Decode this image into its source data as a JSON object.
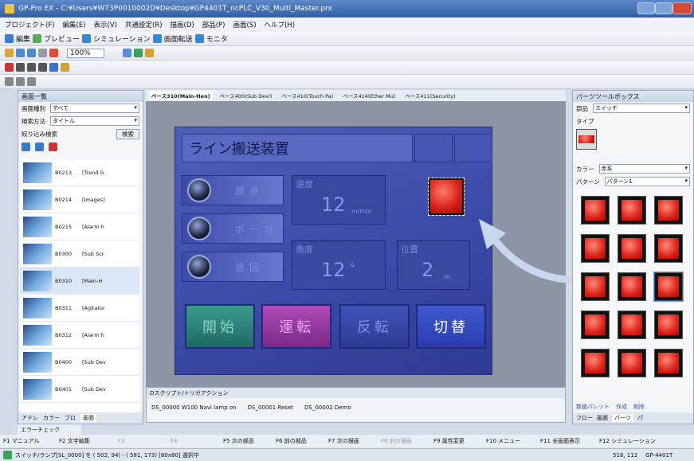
{
  "window": {
    "title": "GP-Pro EX - C:¥Users¥W73P0010002D¥Desktop¥GP4401T_ncPLC_V30_Multi_Master.prx"
  },
  "menu": [
    "プロジェクト(F)",
    "編集(E)",
    "表示(V)",
    "共通設定(R)",
    "描画(D)",
    "部品(P)",
    "画面(S)",
    "ヘルプ(H)"
  ],
  "toolbar1": {
    "items": [
      "編集",
      "プレビュー",
      "シミュレーション",
      "画面転送",
      "モニタ"
    ]
  },
  "toolbar2": {
    "zoom": "100%"
  },
  "left_panel": {
    "title": "画面一覧",
    "filters": [
      {
        "label": "画面種別",
        "value": "すべて"
      },
      {
        "label": "検索方法",
        "value": "タイトル"
      },
      {
        "label": "絞り込み検索",
        "value": "検索"
      }
    ],
    "rows": [
      {
        "id": "B0213",
        "name": "[Trend G"
      },
      {
        "id": "B0214",
        "name": "[Images]"
      },
      {
        "id": "B0215",
        "name": "[Alarm h"
      },
      {
        "id": "B0300",
        "name": "[Sub Scr"
      },
      {
        "id": "B0310",
        "name": "[Main-H"
      },
      {
        "id": "B0311",
        "name": "[Agitator"
      },
      {
        "id": "B0312",
        "name": "[Alarm h"
      },
      {
        "id": "B0400",
        "name": "[Sub Dev"
      },
      {
        "id": "B0401",
        "name": "[Sub Dev"
      }
    ],
    "tabs": [
      "アドレ",
      "カラー",
      "ブロ",
      "画面"
    ]
  },
  "editor": {
    "tabs": [
      "ベース310(Main-Hen)",
      "ベース400(Sub Devi)",
      "ベース410(Touch Pa)",
      "ベース414(Ether Mu)",
      "ベース411(Security)"
    ]
  },
  "hmi": {
    "title": "ライン搬送装置",
    "lamps": [
      "原点",
      "ボーガ",
      "途回"
    ],
    "speed": {
      "label": "速度",
      "value": "12",
      "unit": "m/min"
    },
    "angle": {
      "label": "角度",
      "value": "12",
      "unit": "°"
    },
    "position": {
      "label": "位置",
      "value": "2",
      "unit": "m"
    },
    "buttons": [
      "開始",
      "運転",
      "反転",
      "切替"
    ]
  },
  "right_panel": {
    "title": "パーツツールボックス",
    "part_label": "部品",
    "part_value": "スイッチ",
    "type_label": "タイプ",
    "color_label": "カラー",
    "color_value": "赤系",
    "pattern_label": "パターン",
    "pattern_value": "パターン1",
    "bottom": [
      "数値パレット",
      "作成",
      "削除"
    ],
    "tabs": [
      "フロー",
      "画面",
      "パーツ",
      "パ"
    ]
  },
  "bottom_panel": {
    "title": "Dスクリプト/トリガアクション",
    "items": [
      "DS_00000 W100 Navi lamp on",
      "DS_00001 Reset",
      "DS_00002 Demo"
    ],
    "error_tab": "エラーチェック"
  },
  "fkeys": [
    "F1 マニュアル",
    "F2 文字編集",
    "F3",
    "F4",
    "F5 次の部品",
    "F6 前の部品",
    "F7 次の描画",
    "F8 前の描画",
    "F9 属性変更",
    "F10 メニュー",
    "F11 全画面表示",
    "F12 シミュレーション"
  ],
  "status": {
    "text": "スイッチ/ランプ[SL_0000] を ( 502, 94) - ( 581, 173) [80x80] 選択中",
    "coords": "518, 112",
    "model": "GP-4401T"
  }
}
